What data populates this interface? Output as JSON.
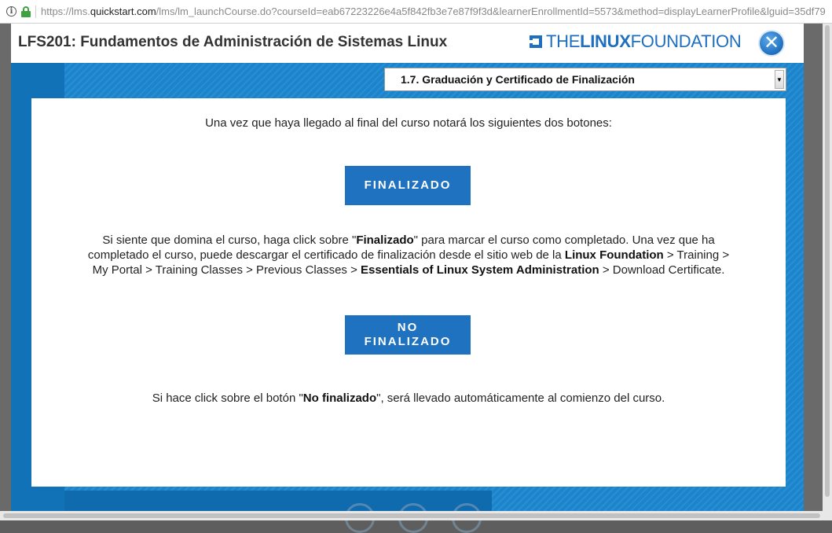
{
  "browser": {
    "url_prefix": "https://lms.",
    "url_host": "quickstart.com",
    "url_rest": "/lms/lm_launchCourse.do?courseId=eab67223226e4a5f842fb3e7e87f9f3d&learnerEnrollmentId=5573&method=displayLearnerProfile&lguid=35df79"
  },
  "header": {
    "course_title": "LFS201: Fundamentos de Administración de Sistemas Linux",
    "logo_the": "THE",
    "logo_linux": "LINUX",
    "logo_foundation": "FOUNDATION",
    "close_glyph": "✕"
  },
  "section_selector": {
    "selected": "1.7. Graduación y Certificado de Finalización",
    "arrow_glyph": "▼"
  },
  "content": {
    "intro": "Una vez que haya llegado al final del curso notará los siguientes dos botones:",
    "btn_finalizado": "FINALIZADO",
    "p2_a": "Si siente que domina el curso, haga click sobre \"",
    "p2_b": "Finalizado",
    "p2_c": "\" para marcar el curso como completado. Una vez que ha completado el curso, puede descargar el certificado de finalización desde el sitio web de la ",
    "p2_d": "Linux Foundation",
    "p2_e": " > Training > My Portal > Training Classes > Previous Classes > ",
    "p2_f": "Essentials of Linux System Administration",
    "p2_g": " > Download Certificate.",
    "btn_no_line1": "NO",
    "btn_no_line2": "FINALIZADO",
    "p3_a": "Si hace click sobre el botón \"",
    "p3_b": "No finalizado",
    "p3_c": "\", será llevado automáticamente al comienzo del curso."
  },
  "colors": {
    "accent": "#1f72bf",
    "content_bg": "#1a85cc",
    "lock": "#3fa13f"
  },
  "icons": [
    "info-icon",
    "lock-icon",
    "close-icon",
    "dropdown-arrow-icon",
    "linux-foundation-logo"
  ]
}
